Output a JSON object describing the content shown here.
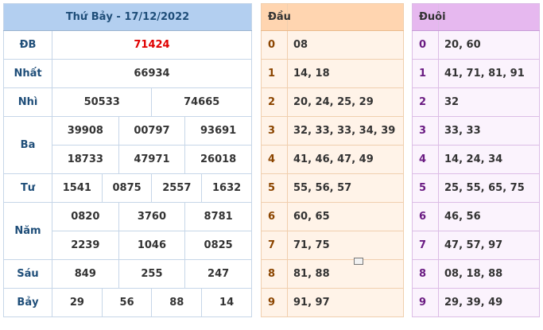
{
  "results": {
    "title": "Thứ Bảy - 17/12/2022",
    "prizes": {
      "db": {
        "label": "ĐB",
        "values": [
          "71424"
        ]
      },
      "nhat": {
        "label": "Nhất",
        "values": [
          "66934"
        ]
      },
      "nhi": {
        "label": "Nhì",
        "values": [
          "50533",
          "74665"
        ]
      },
      "ba": {
        "label": "Ba",
        "values": [
          "39908",
          "00797",
          "93691",
          "18733",
          "47971",
          "26018"
        ]
      },
      "tu": {
        "label": "Tư",
        "values": [
          "1541",
          "0875",
          "2557",
          "1632"
        ]
      },
      "nam": {
        "label": "Năm",
        "values": [
          "0820",
          "3760",
          "8781",
          "2239",
          "1046",
          "0825"
        ]
      },
      "sau": {
        "label": "Sáu",
        "values": [
          "849",
          "255",
          "247"
        ]
      },
      "bay": {
        "label": "Bảy",
        "values": [
          "29",
          "56",
          "88",
          "14"
        ]
      }
    }
  },
  "dau": {
    "header": "Đầu",
    "rows": [
      {
        "digit": "0",
        "values": "08"
      },
      {
        "digit": "1",
        "values": "14, 18"
      },
      {
        "digit": "2",
        "values": "20, 24, 25, 29"
      },
      {
        "digit": "3",
        "values": "32, 33, 33, 34, 39"
      },
      {
        "digit": "4",
        "values": "41, 46, 47, 49"
      },
      {
        "digit": "5",
        "values": "55, 56, 57"
      },
      {
        "digit": "6",
        "values": "60, 65"
      },
      {
        "digit": "7",
        "values": "71, 75"
      },
      {
        "digit": "8",
        "values": "81, 88"
      },
      {
        "digit": "9",
        "values": "91, 97"
      }
    ]
  },
  "duoi": {
    "header": "Đuôi",
    "rows": [
      {
        "digit": "0",
        "values": "20, 60"
      },
      {
        "digit": "1",
        "values": "41, 71, 81, 91"
      },
      {
        "digit": "2",
        "values": "32"
      },
      {
        "digit": "3",
        "values": "33, 33"
      },
      {
        "digit": "4",
        "values": "14, 24, 34"
      },
      {
        "digit": "5",
        "values": "25, 55, 65, 75"
      },
      {
        "digit": "6",
        "values": "46, 56"
      },
      {
        "digit": "7",
        "values": "47, 57, 97"
      },
      {
        "digit": "8",
        "values": "08, 18, 88"
      },
      {
        "digit": "9",
        "values": "29, 39, 49"
      }
    ]
  },
  "colors": {
    "special_prize": "#e00000",
    "results_header": "#b3cff0",
    "dau_header": "#ffd5b0",
    "duoi_header": "#e6b8ef"
  }
}
